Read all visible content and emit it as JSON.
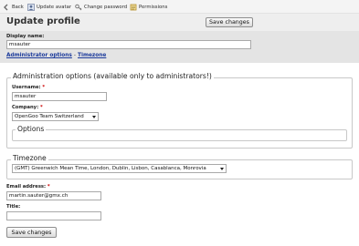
{
  "toolbar": {
    "back": "Back",
    "update_avatar": "Update avatar",
    "change_password": "Change password",
    "permissions": "Permissions"
  },
  "header": {
    "title": "Update profile",
    "save_button": "Save changes"
  },
  "display_name": {
    "label": "Display name:",
    "value": "msauter"
  },
  "links": {
    "admin_options": "Administrator options",
    "separator": "-",
    "timezone": "Timezone"
  },
  "admin_section": {
    "legend": "Administration options (available only to administrators!)",
    "username_label": "Username:",
    "username_value": "msauter",
    "company_label": "Company:",
    "company_value": "OpenGoo Team Switzerland",
    "options_legend": "Options"
  },
  "timezone_section": {
    "legend": "Timezone",
    "value": "(GMT) Greenwich Mean Time, London, Dublin, Lisbon, Casablanca, Monrovia"
  },
  "email": {
    "label": "Email address:",
    "value": "martin.sauter@gmx.ch"
  },
  "title_field": {
    "label": "Title:",
    "value": ""
  },
  "required_marker": "*",
  "footer": {
    "save_button": "Save changes"
  }
}
